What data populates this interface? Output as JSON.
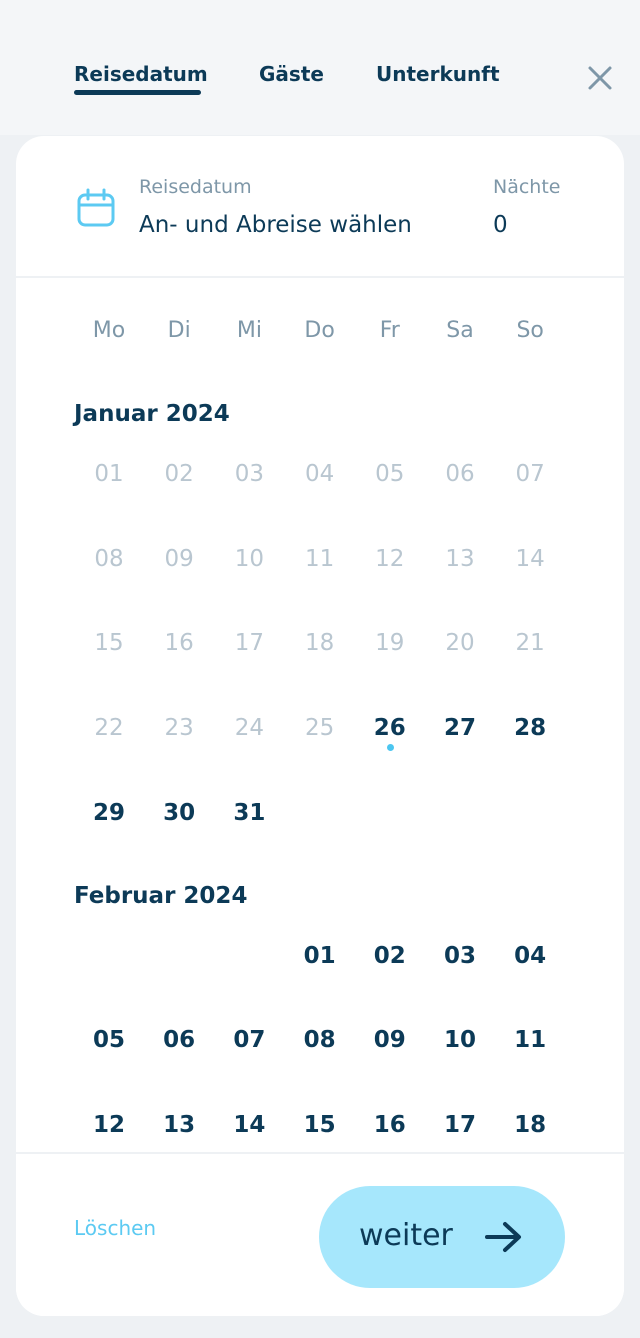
{
  "tabs": [
    {
      "label": "Reisedatum",
      "active": true
    },
    {
      "label": "Gäste",
      "active": false
    },
    {
      "label": "Unterkunft",
      "active": false
    }
  ],
  "header": {
    "date_label": "Reisedatum",
    "date_value": "An- und Abreise wählen",
    "nights_label": "Nächte",
    "nights_value": "0"
  },
  "weekdays": [
    "Mo",
    "Di",
    "Mi",
    "Do",
    "Fr",
    "Sa",
    "So"
  ],
  "months": [
    {
      "title": "Januar 2024",
      "rows": [
        [
          {
            "d": "01",
            "s": "past"
          },
          {
            "d": "02",
            "s": "past"
          },
          {
            "d": "03",
            "s": "past"
          },
          {
            "d": "04",
            "s": "past"
          },
          {
            "d": "05",
            "s": "past"
          },
          {
            "d": "06",
            "s": "past"
          },
          {
            "d": "07",
            "s": "past"
          }
        ],
        [
          {
            "d": "08",
            "s": "past"
          },
          {
            "d": "09",
            "s": "past"
          },
          {
            "d": "10",
            "s": "past"
          },
          {
            "d": "11",
            "s": "past"
          },
          {
            "d": "12",
            "s": "past"
          },
          {
            "d": "13",
            "s": "past"
          },
          {
            "d": "14",
            "s": "past"
          }
        ],
        [
          {
            "d": "15",
            "s": "past"
          },
          {
            "d": "16",
            "s": "past"
          },
          {
            "d": "17",
            "s": "past"
          },
          {
            "d": "18",
            "s": "past"
          },
          {
            "d": "19",
            "s": "past"
          },
          {
            "d": "20",
            "s": "past"
          },
          {
            "d": "21",
            "s": "past"
          }
        ],
        [
          {
            "d": "22",
            "s": "past"
          },
          {
            "d": "23",
            "s": "past"
          },
          {
            "d": "24",
            "s": "past"
          },
          {
            "d": "25",
            "s": "past"
          },
          {
            "d": "26",
            "s": "today"
          },
          {
            "d": "27",
            "s": "avail"
          },
          {
            "d": "28",
            "s": "avail"
          }
        ],
        [
          {
            "d": "29",
            "s": "avail"
          },
          {
            "d": "30",
            "s": "avail"
          },
          {
            "d": "31",
            "s": "avail"
          },
          null,
          null,
          null,
          null
        ]
      ]
    },
    {
      "title": "Februar 2024",
      "rows": [
        [
          null,
          null,
          null,
          {
            "d": "01",
            "s": "avail"
          },
          {
            "d": "02",
            "s": "avail"
          },
          {
            "d": "03",
            "s": "avail"
          },
          {
            "d": "04",
            "s": "avail"
          }
        ],
        [
          {
            "d": "05",
            "s": "avail"
          },
          {
            "d": "06",
            "s": "avail"
          },
          {
            "d": "07",
            "s": "avail"
          },
          {
            "d": "08",
            "s": "avail"
          },
          {
            "d": "09",
            "s": "avail"
          },
          {
            "d": "10",
            "s": "avail"
          },
          {
            "d": "11",
            "s": "avail"
          }
        ],
        [
          {
            "d": "12",
            "s": "avail"
          },
          {
            "d": "13",
            "s": "avail"
          },
          {
            "d": "14",
            "s": "avail"
          },
          {
            "d": "15",
            "s": "avail"
          },
          {
            "d": "16",
            "s": "avail"
          },
          {
            "d": "17",
            "s": "avail"
          },
          {
            "d": "18",
            "s": "avail"
          }
        ]
      ]
    }
  ],
  "footer": {
    "clear_label": "Löschen",
    "next_label": "weiter"
  },
  "colors": {
    "primary": "#0c3a57",
    "accent": "#5ccaf2",
    "button_bg": "#a6e7fc",
    "muted": "#b9c6d0"
  },
  "icons": {
    "close": "close-icon",
    "calendar": "calendar-icon",
    "next": "arrow-right-icon"
  }
}
